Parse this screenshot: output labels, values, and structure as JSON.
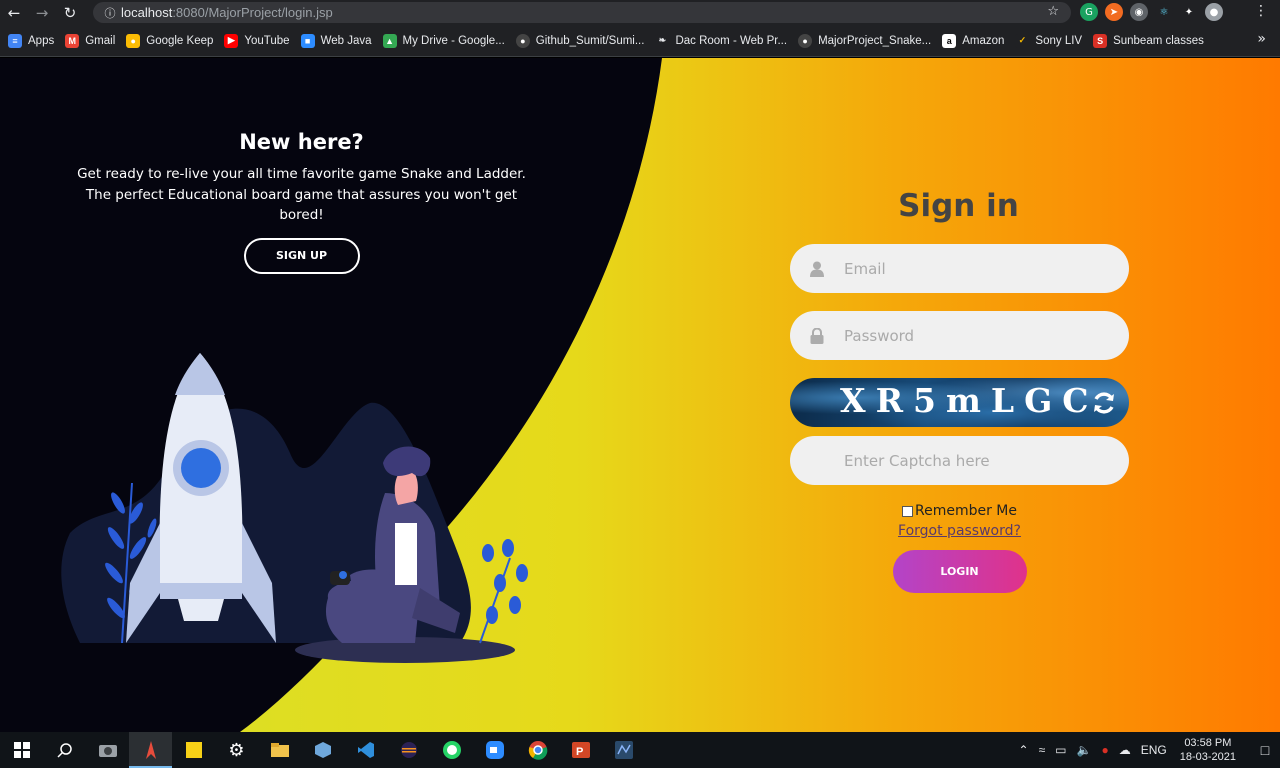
{
  "browser": {
    "url_host": "localhost",
    "url_path": ":8080/MajorProject/login.jsp",
    "bookmarks": [
      {
        "label": "Apps",
        "color": "#4285f4"
      },
      {
        "label": "Gmail",
        "color": "#ea4335"
      },
      {
        "label": "Google Keep",
        "color": "#fbbc04"
      },
      {
        "label": "YouTube",
        "color": "#ff0000"
      },
      {
        "label": "Web Java",
        "color": "#2d8cff"
      },
      {
        "label": "My Drive - Google...",
        "color": "#34a853"
      },
      {
        "label": "Github_Sumit/Sumi...",
        "color": "#444444"
      },
      {
        "label": "Dac Room - Web Pr...",
        "color": "#e8eaed"
      },
      {
        "label": "MajorProject_Snake...",
        "color": "#444444"
      },
      {
        "label": "Amazon",
        "color": "#ffffff"
      },
      {
        "label": "Sony LIV",
        "color": "#f5b800"
      },
      {
        "label": "Sunbeam classes",
        "color": "#d93025"
      }
    ]
  },
  "left": {
    "title": "New here?",
    "text": "Get ready to re-live your all time favorite game Snake and Ladder. The perfect Educational board game that assures you won't get bored!",
    "signup_label": "SIGN UP"
  },
  "signin": {
    "title": "Sign in",
    "email_placeholder": "Email",
    "password_placeholder": "Password",
    "captcha_text": "XR5mLGC",
    "captcha_input_placeholder": "Enter Captcha here",
    "remember_label": "Remember Me",
    "forgot_label": "Forgot password?",
    "login_label": "LOGIN"
  },
  "taskbar": {
    "time": "03:58 PM",
    "date": "18-03-2021",
    "lang": "ENG"
  }
}
